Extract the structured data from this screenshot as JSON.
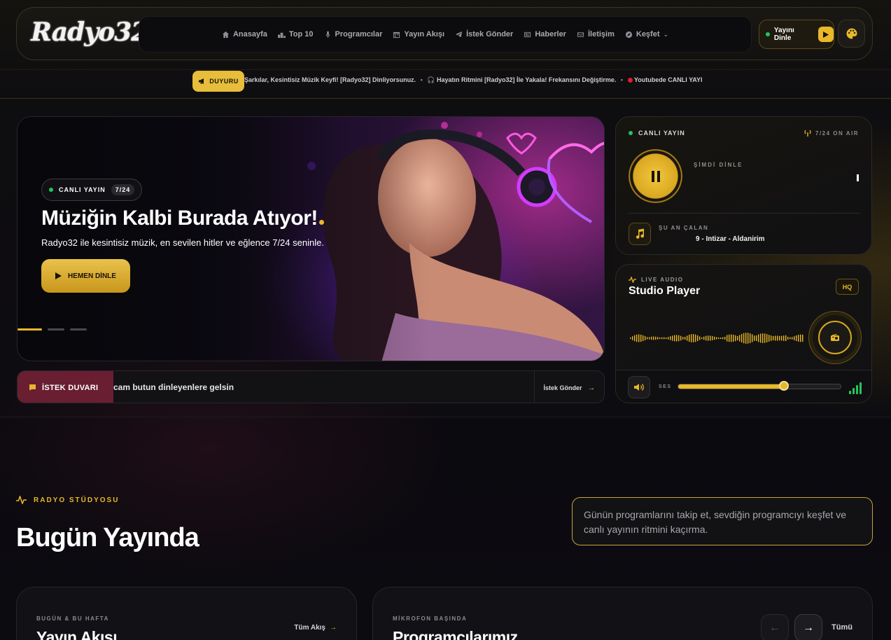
{
  "header": {
    "logo": "Radyo32",
    "nav": [
      {
        "label": "Anasayfa",
        "icon": "home-icon"
      },
      {
        "label": "Top 10",
        "icon": "podium-icon"
      },
      {
        "label": "Programcılar",
        "icon": "mic-icon"
      },
      {
        "label": "Yayın Akışı",
        "icon": "calendar-icon"
      },
      {
        "label": "İstek Gönder",
        "icon": "send-icon"
      },
      {
        "label": "Haberler",
        "icon": "news-icon"
      },
      {
        "label": "İletişim",
        "icon": "mail-icon"
      },
      {
        "label": "Keşfet",
        "icon": "compass-icon"
      }
    ],
    "listen_label": "Yayını Dinle",
    "theme_icon": "palette-icon"
  },
  "ticker": {
    "badge": "DUYURU",
    "text_1": "Şarkılar, Kesintisiz Müzik Keyfi! [Radyo32] Dinliyorsunuz.",
    "text_2": "🎧 Hayatın Ritmini [Radyo32] İle Yakala! Frekansını Değiştirme.",
    "text_3": "Youtubede CANLI YAYI"
  },
  "hero": {
    "live_label": "CANLI YAYIN",
    "live_badge": "7/24",
    "title": "Müziğin Kalbi Burada Atıyor!",
    "subtitle": "Radyo32 ile kesintisiz müzik, en sevilen hitler ve eğlence 7/24 seninle.",
    "cta": "HEMEN DİNLE",
    "slides": 3,
    "active_slide": 0
  },
  "request_wall": {
    "tag": "İSTEK DUVARI",
    "message": "cam butun dinleyenlere gelsin",
    "send": "İstek Gönder"
  },
  "live_card": {
    "live_label": "CANLI YAYIN",
    "on_air": "7/24 ON AIR",
    "now_listen": "ŞİMDİ DİNLE",
    "now_playing_label": "ŞU AN ÇALAN",
    "song": "9 - Intizar - Aldanirim"
  },
  "studio_player": {
    "eyebrow": "LIVE AUDIO",
    "title": "Studio Player",
    "quality": "HQ",
    "volume_label": "SES",
    "volume": 0.65,
    "accent": "#e8b828"
  },
  "section": {
    "eyebrow": "RADYO STÜDYOSU",
    "title": "Bugün Yayında",
    "description": "Günün programlarını takip et, sevdiğin programcıyı keşfet ve canlı yayının ritmini kaçırma."
  },
  "schedule_card": {
    "eyebrow": "BUGÜN & BU HAFTA",
    "title": "Yayın Akışı",
    "link": "Tüm Akış"
  },
  "hosts_card": {
    "eyebrow": "MİKROFON BAŞINDA",
    "title": "Programcılarımız",
    "link": "Tümü"
  }
}
